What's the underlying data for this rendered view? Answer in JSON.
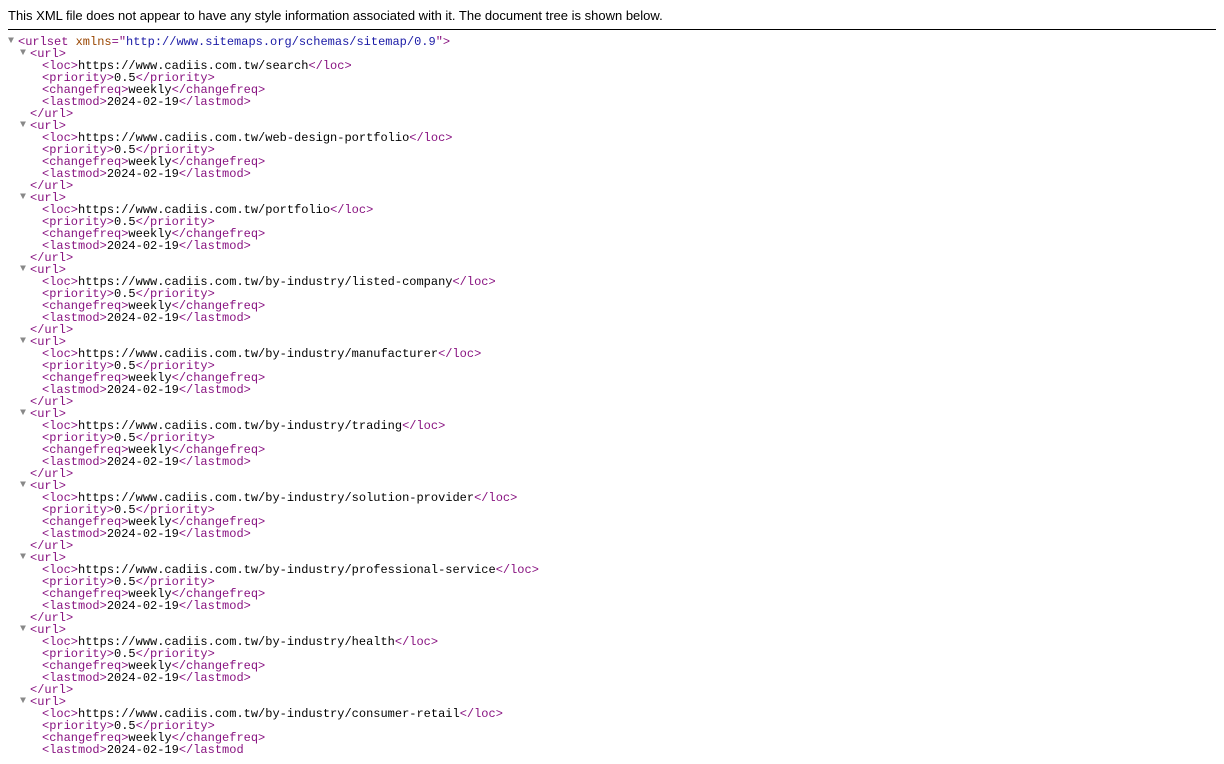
{
  "header_message": "This XML file does not appear to have any style information associated with it. The document tree is shown below.",
  "root": {
    "tag": "urlset",
    "attr_name": "xmlns",
    "attr_value": "http://www.sitemaps.org/schemas/sitemap/0.9"
  },
  "urls": [
    {
      "loc": "https://www.cadiis.com.tw/search",
      "priority": "0.5",
      "changefreq": "weekly",
      "lastmod": "2024-02-19"
    },
    {
      "loc": "https://www.cadiis.com.tw/web-design-portfolio",
      "priority": "0.5",
      "changefreq": "weekly",
      "lastmod": "2024-02-19"
    },
    {
      "loc": "https://www.cadiis.com.tw/portfolio",
      "priority": "0.5",
      "changefreq": "weekly",
      "lastmod": "2024-02-19"
    },
    {
      "loc": "https://www.cadiis.com.tw/by-industry/listed-company",
      "priority": "0.5",
      "changefreq": "weekly",
      "lastmod": "2024-02-19"
    },
    {
      "loc": "https://www.cadiis.com.tw/by-industry/manufacturer",
      "priority": "0.5",
      "changefreq": "weekly",
      "lastmod": "2024-02-19"
    },
    {
      "loc": "https://www.cadiis.com.tw/by-industry/trading",
      "priority": "0.5",
      "changefreq": "weekly",
      "lastmod": "2024-02-19"
    },
    {
      "loc": "https://www.cadiis.com.tw/by-industry/solution-provider",
      "priority": "0.5",
      "changefreq": "weekly",
      "lastmod": "2024-02-19"
    },
    {
      "loc": "https://www.cadiis.com.tw/by-industry/professional-service",
      "priority": "0.5",
      "changefreq": "weekly",
      "lastmod": "2024-02-19"
    },
    {
      "loc": "https://www.cadiis.com.tw/by-industry/health",
      "priority": "0.5",
      "changefreq": "weekly",
      "lastmod": "2024-02-19"
    },
    {
      "loc": "https://www.cadiis.com.tw/by-industry/consumer-retail",
      "priority": "0.5",
      "changefreq": "weekly",
      "lastmod": "2024-02-19",
      "lastmod_pending": true
    }
  ],
  "labels": {
    "url": "url",
    "loc": "loc",
    "priority": "priority",
    "changefreq": "changefreq",
    "lastmod": "lastmod"
  }
}
